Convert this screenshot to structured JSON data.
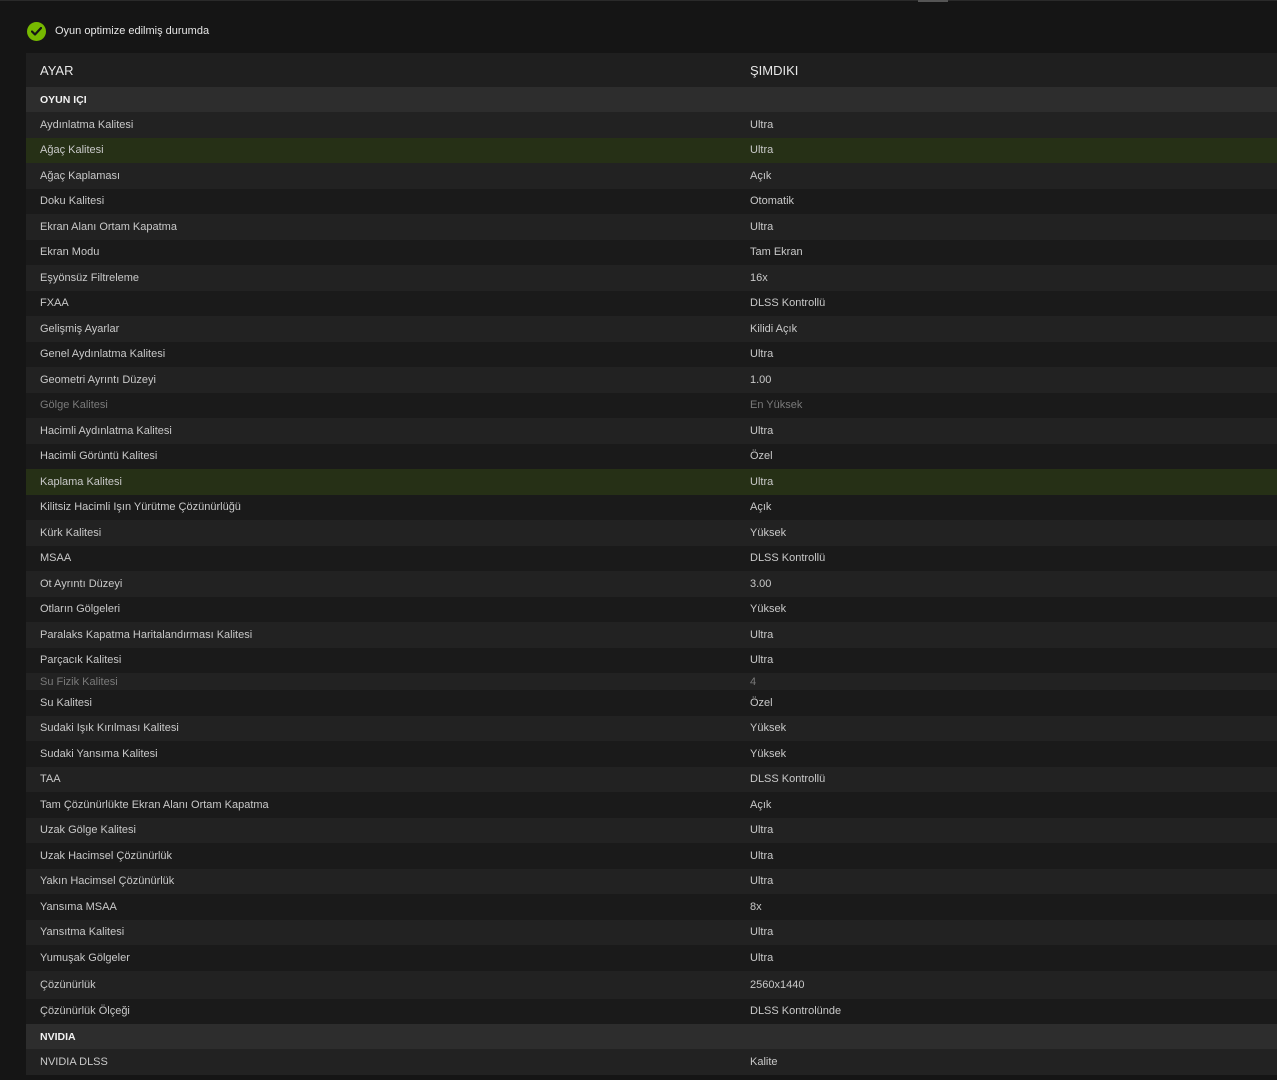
{
  "status": {
    "text": "Oyun optimize edilmiş durumda",
    "icon": "check-icon",
    "icon_color": "#76b900"
  },
  "table": {
    "headers": {
      "setting": "AYAR",
      "current": "ŞIMDIKI"
    },
    "sections": [
      {
        "title": "OYUN IÇI",
        "rows": [
          {
            "setting": "Aydınlatma Kalitesi",
            "value": "Ultra"
          },
          {
            "setting": "Ağaç Kalitesi",
            "value": "Ultra",
            "highlight": true
          },
          {
            "setting": "Ağaç Kaplaması",
            "value": "Açık"
          },
          {
            "setting": "Doku Kalitesi",
            "value": "Otomatik"
          },
          {
            "setting": "Ekran Alanı Ortam Kapatma",
            "value": "Ultra"
          },
          {
            "setting": "Ekran Modu",
            "value": "Tam Ekran"
          },
          {
            "setting": "Eşyönsüz Filtreleme",
            "value": "16x"
          },
          {
            "setting": "FXAA",
            "value": "DLSS Kontrollü"
          },
          {
            "setting": "Gelişmiş Ayarlar",
            "value": "Kilidi Açık"
          },
          {
            "setting": "Genel Aydınlatma Kalitesi",
            "value": "Ultra"
          },
          {
            "setting": "Geometri Ayrıntı Düzeyi",
            "value": "1.00"
          },
          {
            "setting": "Gölge Kalitesi",
            "value": "En Yüksek",
            "dim": true
          },
          {
            "setting": "Hacimli Aydınlatma Kalitesi",
            "value": "Ultra"
          },
          {
            "setting": "Hacimli Görüntü Kalitesi",
            "value": "Özel"
          },
          {
            "setting": "Kaplama Kalitesi",
            "value": "Ultra",
            "highlight": true
          },
          {
            "setting": "Kilitsiz Hacimli Işın Yürütme Çözünürlüğü",
            "value": "Açık"
          },
          {
            "setting": "Kürk Kalitesi",
            "value": "Yüksek"
          },
          {
            "setting": "MSAA",
            "value": "DLSS Kontrollü"
          },
          {
            "setting": "Ot Ayrıntı Düzeyi",
            "value": "3.00"
          },
          {
            "setting": "Otların Gölgeleri",
            "value": "Yüksek"
          },
          {
            "setting": "Paralaks Kapatma Haritalandırması Kalitesi",
            "value": "Ultra"
          },
          {
            "setting": "Parçacık Kalitesi",
            "value": "Ultra"
          },
          {
            "setting": "Su Fizik Kalitesi",
            "value": "4",
            "dim": true,
            "short": true
          },
          {
            "setting": "Su Kalitesi",
            "value": "Özel"
          },
          {
            "setting": "Sudaki Işık Kırılması Kalitesi",
            "value": "Yüksek"
          },
          {
            "setting": "Sudaki Yansıma Kalitesi",
            "value": "Yüksek"
          },
          {
            "setting": "TAA",
            "value": "DLSS Kontrollü"
          },
          {
            "setting": "Tam Çözünürlükte Ekran Alanı Ortam Kapatma",
            "value": "Açık"
          },
          {
            "setting": "Uzak Gölge Kalitesi",
            "value": "Ultra"
          },
          {
            "setting": "Uzak Hacimsel Çözünürlük",
            "value": "Ultra"
          },
          {
            "setting": "Yakın Hacimsel Çözünürlük",
            "value": "Ultra"
          },
          {
            "setting": "Yansıma MSAA",
            "value": "8x"
          },
          {
            "setting": "Yansıtma Kalitesi",
            "value": "Ultra"
          },
          {
            "setting": "Yumuşak Gölgeler",
            "value": "Ultra"
          },
          {
            "setting": "Çözünürlük",
            "value": "2560x1440",
            "tall": true
          },
          {
            "setting": "Çözünürlük Ölçeği",
            "value": "DLSS Kontrolünde"
          }
        ]
      },
      {
        "title": "NVIDIA",
        "rows": [
          {
            "setting": "NVIDIA DLSS",
            "value": "Kalite"
          }
        ]
      }
    ]
  }
}
